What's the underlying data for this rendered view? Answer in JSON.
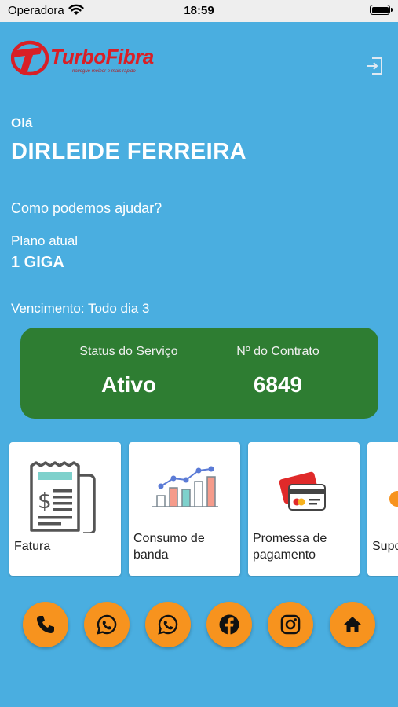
{
  "statusbar": {
    "carrier": "Operadora",
    "time": "18:59"
  },
  "brand": {
    "name": "TurboFibra",
    "tagline": "navegue melhor e mais rápido",
    "color": "#d91f26"
  },
  "greeting": {
    "hello": "Olá",
    "name": "DIRLEIDE FERREIRA",
    "help": "Como podemos ajudar?"
  },
  "plan": {
    "label": "Plano atual",
    "value": "1 GIGA"
  },
  "due": "Vencimento: Todo dia 3",
  "service": {
    "status_label": "Status do Serviço",
    "status_value": "Ativo",
    "contract_label": "Nº do Contrato",
    "contract_value": "6849",
    "color": "#2e7d32"
  },
  "cards": [
    {
      "label": "Fatura",
      "icon": "invoice-icon"
    },
    {
      "label": "Consumo de banda",
      "icon": "bandwidth-chart-icon"
    },
    {
      "label": "Promessa de pagamento",
      "icon": "credit-card-icon"
    },
    {
      "label": "Suporte",
      "icon": "support-icon"
    }
  ],
  "actions": [
    {
      "icon": "phone-icon"
    },
    {
      "icon": "whatsapp-icon"
    },
    {
      "icon": "whatsapp-icon"
    },
    {
      "icon": "facebook-icon"
    },
    {
      "icon": "instagram-icon"
    },
    {
      "icon": "home-icon"
    }
  ],
  "colors": {
    "background": "#4aaee0",
    "action_button": "#f7931e"
  }
}
